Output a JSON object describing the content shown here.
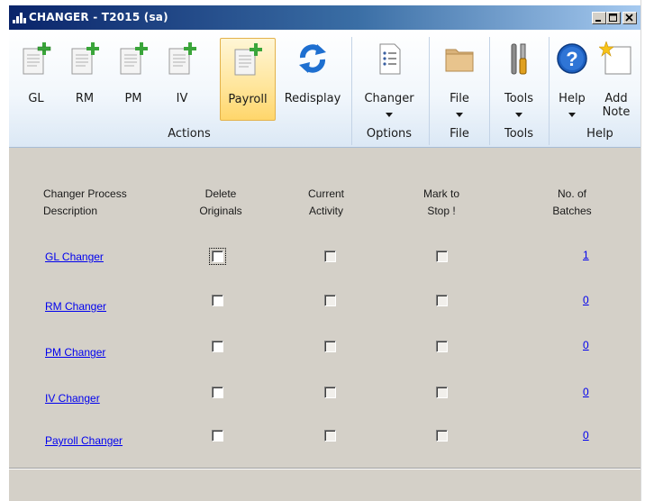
{
  "window": {
    "title": "CHANGER  -  T2015 (sa)"
  },
  "ribbon": {
    "buttons": [
      {
        "label": "GL",
        "icon": "document-add-icon"
      },
      {
        "label": "RM",
        "icon": "document-add-icon"
      },
      {
        "label": "PM",
        "icon": "document-add-icon"
      },
      {
        "label": "IV",
        "icon": "document-add-icon"
      },
      {
        "label": "Payroll",
        "icon": "document-add-icon"
      },
      {
        "label": "Redisplay",
        "icon": "refresh-icon"
      },
      {
        "label": "Changer",
        "icon": "options-list-icon"
      },
      {
        "label": "File",
        "icon": "folder-icon"
      },
      {
        "label": "Tools",
        "icon": "tools-icon"
      },
      {
        "label": "Help",
        "icon": "help-icon"
      },
      {
        "label": "Add",
        "label2": "Note",
        "icon": "note-icon"
      }
    ],
    "groups": [
      "Actions",
      "Options",
      "File",
      "Tools",
      "Help"
    ]
  },
  "headers": {
    "desc_line1": "Changer Process",
    "desc_line2": "Description",
    "delete_line1": "Delete",
    "delete_line2": "Originals",
    "current_line1": "Current",
    "current_line2": "Activity",
    "mark_line1": "Mark to",
    "mark_line2": "Stop !",
    "batches_line1": "No. of",
    "batches_line2": "Batches"
  },
  "rows": [
    {
      "name": "GL Changer",
      "batches": "1"
    },
    {
      "name": "RM Changer",
      "batches": "0"
    },
    {
      "name": "PM Changer",
      "batches": "0"
    },
    {
      "name": "IV  Changer",
      "batches": "0"
    },
    {
      "name": "Payroll Changer",
      "batches": "0"
    }
  ],
  "colors": {
    "title_bar": "#0a246a",
    "window_bg": "#d4d0c8",
    "link": "#0000ee",
    "highlight": "#ffe59a"
  }
}
